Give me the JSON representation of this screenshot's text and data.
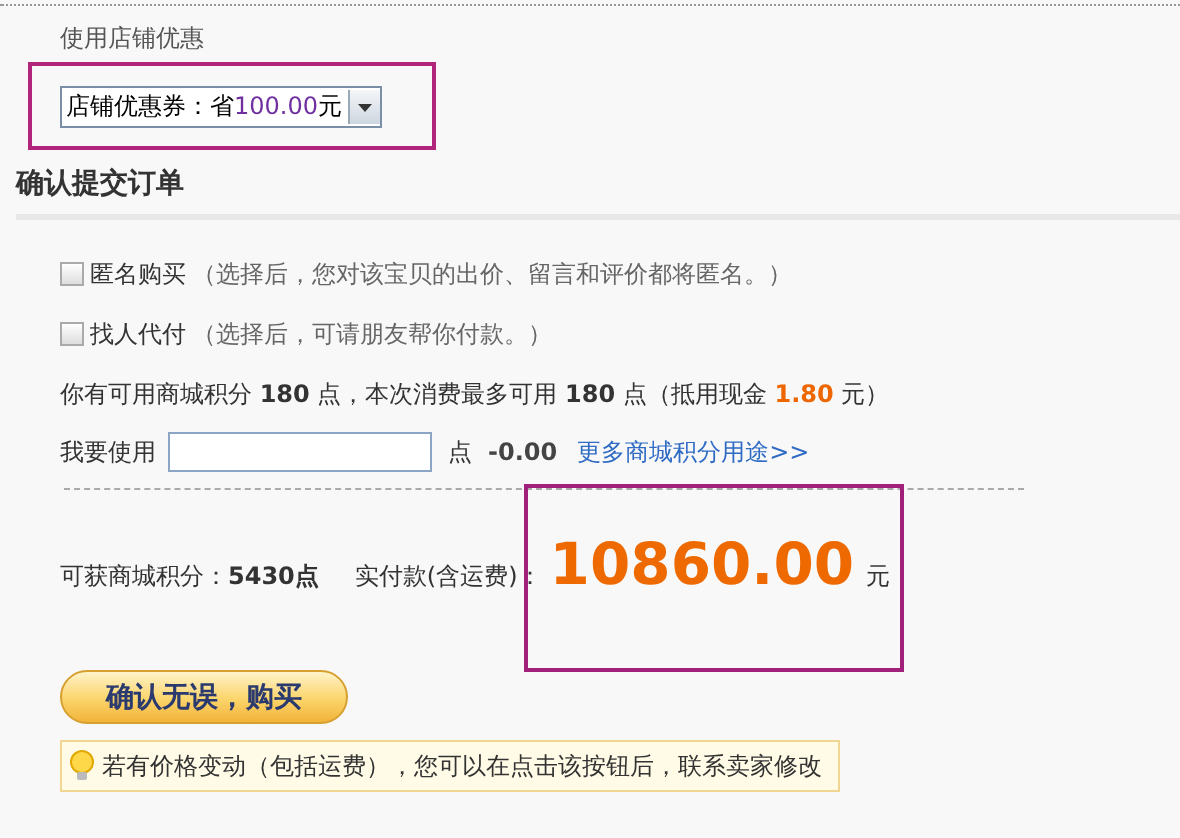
{
  "coupon": {
    "heading": "使用店铺优惠",
    "select": {
      "label": "店铺优惠券：省",
      "amount": "100.00",
      "unit": "元"
    }
  },
  "order": {
    "title": "确认提交订单",
    "options": [
      {
        "label": "匿名购买",
        "note": "（选择后，您对该宝贝的出价、留言和评价都将匿名。）",
        "checked": false
      },
      {
        "label": "找人代付",
        "note": "（选择后，可请朋友帮你付款。）",
        "checked": false
      }
    ],
    "points_info": [
      {
        "kind": "plain",
        "text": "你有可用商城积分 "
      },
      {
        "kind": "bold",
        "text": "180"
      },
      {
        "kind": "plain",
        "text": " 点，本次消费最多可用 "
      },
      {
        "kind": "bold",
        "text": "180"
      },
      {
        "kind": "plain",
        "text": " 点（抵用现金 "
      },
      {
        "kind": "accent",
        "text": "1.80"
      },
      {
        "kind": "plain",
        "text": " 元）"
      }
    ],
    "use_points": {
      "label": "我要使用",
      "unit": "点",
      "deduction": "-0.00",
      "link": "更多商城积分用途>>"
    },
    "earn_label": "可获商城积分：",
    "earn_value": "5430点",
    "pay_label": "实付款(含运费)：",
    "total": "10860.00",
    "currency": "元",
    "submit": "确认无误，购买",
    "tip": "若有价格变动（包括运费），您可以在点击该按钮后，联系卖家修改"
  }
}
